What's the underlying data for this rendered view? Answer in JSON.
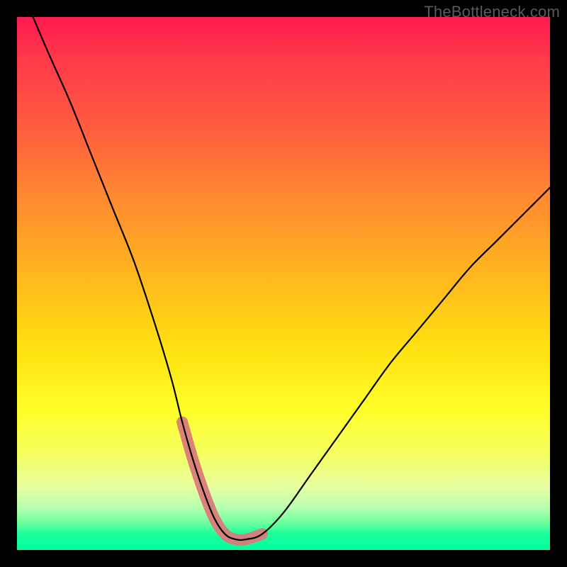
{
  "watermark": "TheBottleneck.com",
  "colors": {
    "background": "#000000",
    "curve": "#000000",
    "fit_marker": "#da7b7a",
    "gradient_top": "#ff1a4f",
    "gradient_bottom": "#00ffa0"
  },
  "chart_data": {
    "type": "line",
    "title": "",
    "xlabel": "",
    "ylabel": "",
    "xlim": [
      0,
      100
    ],
    "ylim": [
      0,
      100
    ],
    "series": [
      {
        "name": "bottleneck-curve",
        "x": [
          3,
          6,
          10,
          14,
          18,
          22,
          26,
          29,
          31,
          33,
          35,
          37,
          39,
          41,
          43,
          46,
          50,
          55,
          60,
          65,
          70,
          75,
          80,
          85,
          90,
          95,
          100
        ],
        "y": [
          100,
          93,
          84,
          74,
          64,
          54,
          42,
          32,
          24,
          17,
          11,
          6,
          3,
          2,
          2,
          3,
          7,
          14,
          21,
          28,
          35,
          41,
          47,
          53,
          58,
          63,
          68
        ]
      },
      {
        "name": "good-fit-region",
        "x": [
          31,
          33,
          35,
          37,
          39,
          41,
          43,
          46
        ],
        "y": [
          24,
          17,
          11,
          6,
          3,
          2,
          2,
          3
        ]
      }
    ],
    "annotations": [
      {
        "text": "TheBottleneck.com",
        "position": "top-right"
      }
    ]
  }
}
